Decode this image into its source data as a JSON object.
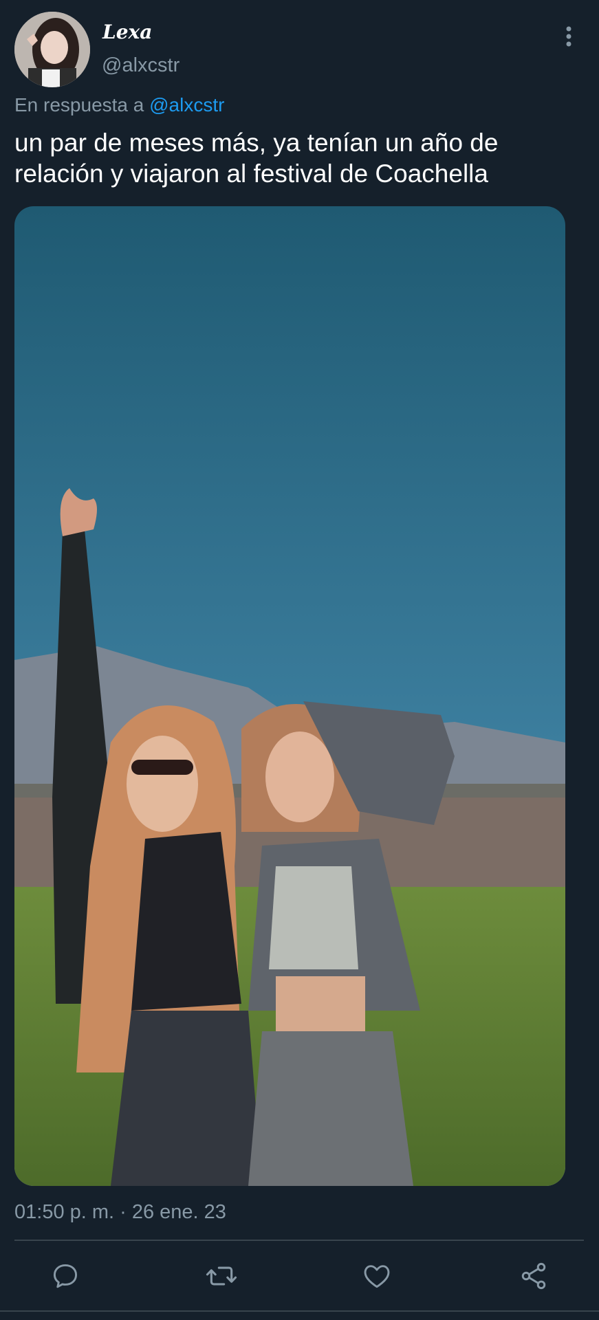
{
  "tweet": {
    "display_name": "Lexa",
    "handle": "@alxcstr",
    "reply_prefix": "En respuesta a",
    "reply_mention": "@alxcstr",
    "text": "un par de meses más, ya tenían un año de relación y viajaron al festival de Coachella",
    "timestamp": "01:50 p. m. · 26 ene. 23",
    "media_alt": "photo"
  },
  "actions": [
    {
      "icon": "reply-icon"
    },
    {
      "icon": "retweet-icon"
    },
    {
      "icon": "like-icon"
    },
    {
      "icon": "share-icon"
    }
  ],
  "colors": {
    "background": "#15202b",
    "secondary_text": "#8899a6",
    "link": "#1d9bf0",
    "divider": "#38444d"
  }
}
